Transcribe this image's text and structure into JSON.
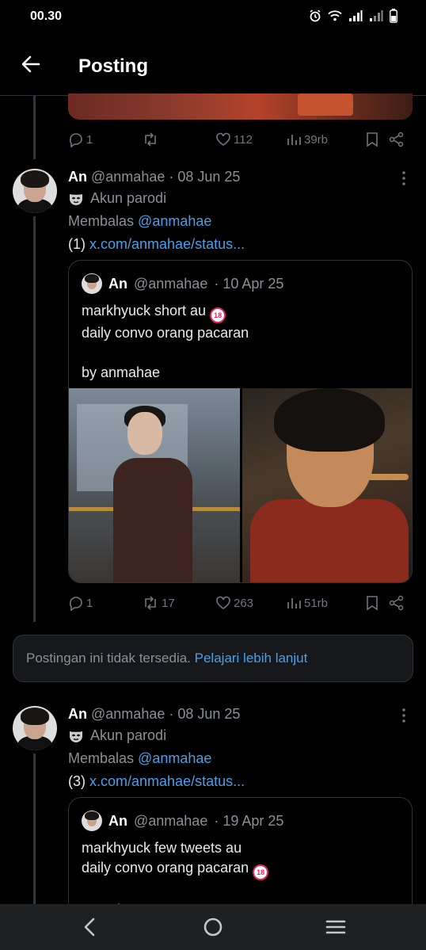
{
  "status_bar": {
    "time": "00.30",
    "icons": [
      "alarm-icon",
      "wifi-icon",
      "signal-icon",
      "signal-weak-icon",
      "battery-icon"
    ]
  },
  "header": {
    "back_icon": "arrow-left-icon",
    "title": "Posting"
  },
  "top_actions": {
    "reply_count": "1",
    "retweet_count": "",
    "like_count": "112",
    "view_count": "39rb"
  },
  "posts": [
    {
      "name": "An",
      "handle": "@anmahae",
      "date": "· 08 Jun 25",
      "parody_label": "Akun parodi",
      "reply_prefix": "Membalas",
      "reply_mention": "@anmahae",
      "link_prefix": "(1)",
      "link_text": "x.com/anmahae/status...",
      "quote": {
        "name": "An",
        "handle": "@anmahae",
        "date": "· 10 Apr 25",
        "line1": "markhyuck short au",
        "line2": "daily convo orang pacaran",
        "line3": "by anmahae",
        "badge": "18"
      },
      "actions": {
        "reply_count": "1",
        "retweet_count": "17",
        "like_count": "263",
        "view_count": "51rb"
      }
    },
    {
      "name": "An",
      "handle": "@anmahae",
      "date": "· 08 Jun 25",
      "parody_label": "Akun parodi",
      "reply_prefix": "Membalas",
      "reply_mention": "@anmahae",
      "link_prefix": "(3)",
      "link_text": "x.com/anmahae/status...",
      "quote": {
        "name": "An",
        "handle": "@anmahae",
        "date": "· 19 Apr 25",
        "line1": "markhyuck few tweets au",
        "line2": "daily convo orang pacaran",
        "line3": "anmahae",
        "badge": "18"
      }
    }
  ],
  "notice": {
    "text": "Postingan ini tidak tersedia.",
    "link": "Pelajari lebih lanjut"
  },
  "nav_bar": {
    "buttons": [
      "back-nav-icon",
      "home-nav-icon",
      "recents-nav-icon"
    ]
  }
}
